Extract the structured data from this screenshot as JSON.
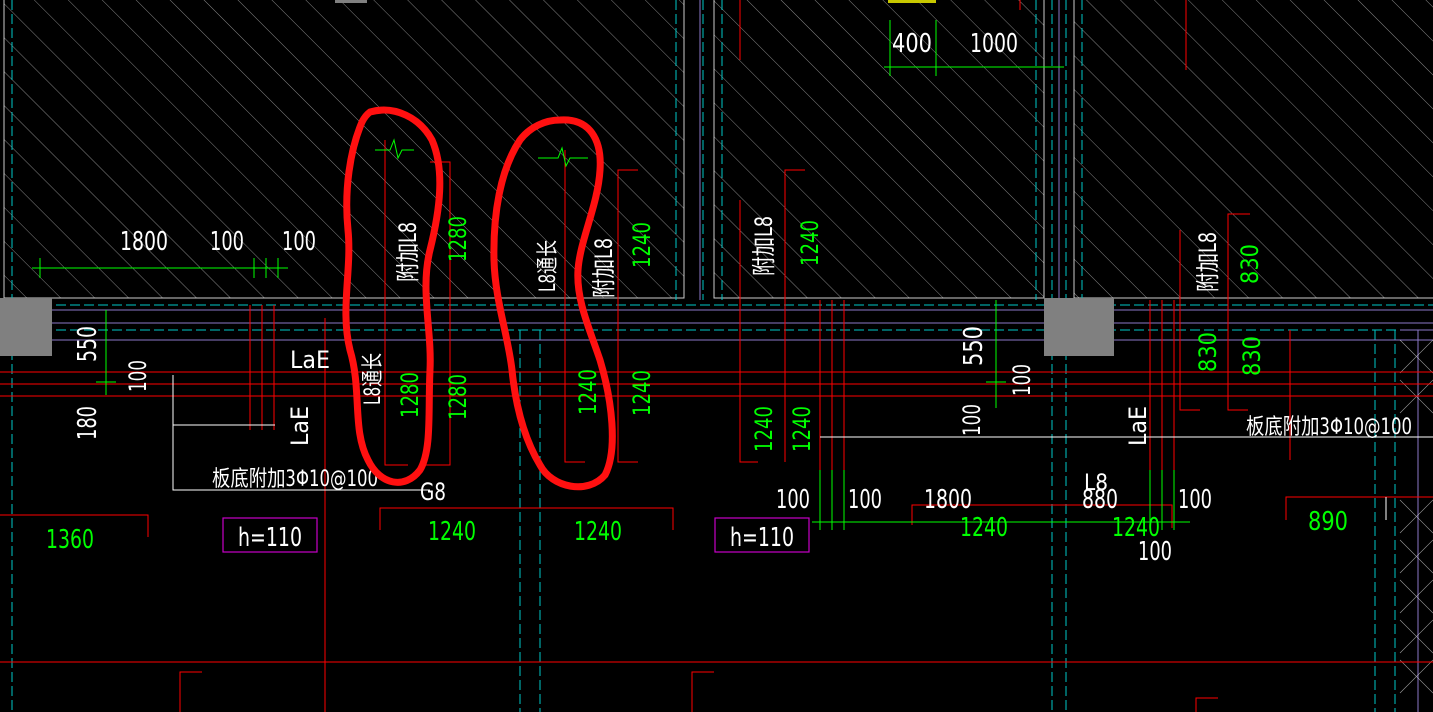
{
  "colors": {
    "background": "#000000",
    "dimension_green": "#00ff00",
    "rebar_red": "#ff0000",
    "axis_cyan": "#00c8c8",
    "beam_edge_violet": "#8c78c8",
    "slab_label_magenta": "#c800c8",
    "text_white": "#ffffff",
    "column_gray": "#808080",
    "highlight_red": "#ff1010"
  },
  "slab_dimensions": {
    "d1800_top": "1800",
    "d100_a": "100",
    "d100_b": "100",
    "d400": "400",
    "d1000": "1000",
    "d550_left": "550",
    "d100_left": "100",
    "d180_left": "180",
    "d550_right": "550",
    "d100_right_a": "100",
    "d100_right_b": "100",
    "d100_mid_a": "100",
    "d100_mid_b": "100",
    "d1800_mid": "1800",
    "d880": "880",
    "d100_mid_c": "100",
    "d100_mid_d": "100"
  },
  "rebar_labels": {
    "fujia_l8_1": "附加L8",
    "l8_tongchang_1": "L8通长",
    "l8_tongchang_2": "L8通长",
    "fujia_l8_2": "附加L8",
    "fujia_l8_3": "附加L8",
    "fujia_l8_4": "附加L8",
    "bandi_left": "板底附加3Φ10@100",
    "bandi_right": "板底附加3Φ10@100",
    "lae_1": "LaE",
    "lae_2": "LaE",
    "lae_3": "LaE",
    "beam_g8": "G8",
    "beam_l8": "L8"
  },
  "rebar_lengths": {
    "r1280_a": "1280",
    "r1280_b": "1280",
    "r1280_c": "1280",
    "r1240_a": "1240",
    "r1240_b": "1240",
    "r1240_c": "1240",
    "r1240_d": "1240",
    "r1240_e": "1240",
    "r1240_f": "1240",
    "r830_a": "830",
    "r830_b": "830",
    "r830_c": "830",
    "b1360": "1360",
    "b1240_a": "1240",
    "b1240_b": "1240",
    "b1240_c": "1240",
    "b1240_d": "1240",
    "b890": "890"
  },
  "slab_thickness": {
    "h1": "h=110",
    "h2": "h=110"
  }
}
